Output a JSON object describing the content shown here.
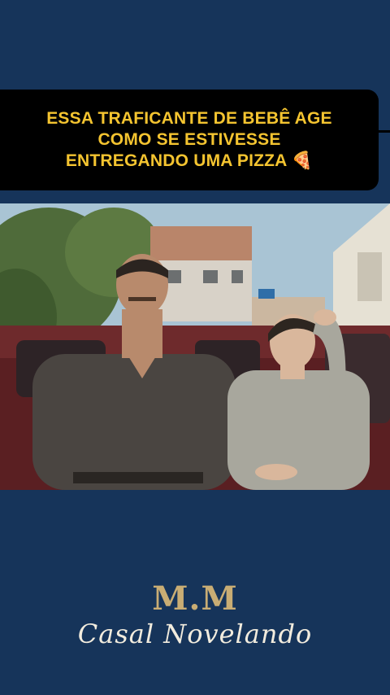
{
  "caption": {
    "lines": [
      "ESSA TRAFICANTE DE BEBÊ AGE",
      "COMO SE ESTIVESSE",
      "ENTREGANDO UMA PIZZA 🍕"
    ]
  },
  "logo": {
    "initials": "M.M",
    "name": "Casal Novelando"
  },
  "colors": {
    "background": "#16345a",
    "caption_text": "#f4c430",
    "logo_gold": "#c9ad74"
  }
}
